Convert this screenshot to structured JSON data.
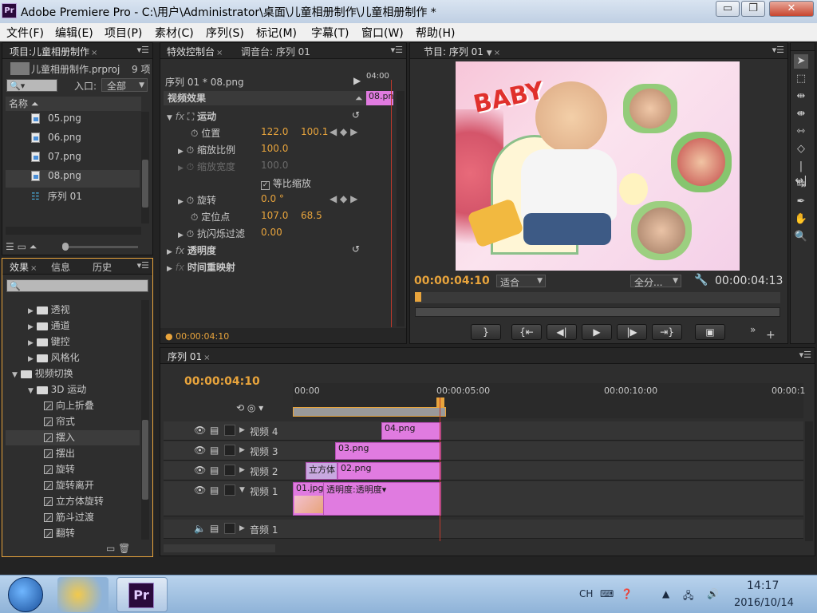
{
  "window": {
    "app_icon": "Pr",
    "title": "Adobe Premiere Pro - C:\\用户\\Administrator\\桌面\\儿童相册制作\\儿童相册制作 *",
    "minimize": "▭",
    "maximize": "❐",
    "close": "✕"
  },
  "menu": [
    "文件(F)",
    "编辑(E)",
    "项目(P)",
    "素材(C)",
    "序列(S)",
    "标记(M)",
    "字幕(T)",
    "窗口(W)",
    "帮助(H)"
  ],
  "project": {
    "tab": "项目:儿童相册制作",
    "file": "儿童相册制作.prproj",
    "count": "9 项",
    "entry_label": "入口:",
    "entry_value": "全部",
    "name_header": "名称",
    "items": [
      "05.png",
      "06.png",
      "07.png",
      "08.png",
      "序列 01"
    ]
  },
  "effects": {
    "tabs": [
      "效果",
      "信息",
      "历史"
    ],
    "tree": [
      {
        "label": "透视",
        "kind": "folder",
        "indent": 1
      },
      {
        "label": "通道",
        "kind": "folder",
        "indent": 1
      },
      {
        "label": "键控",
        "kind": "folder",
        "indent": 1
      },
      {
        "label": "风格化",
        "kind": "folder",
        "indent": 1
      },
      {
        "label": "视频切换",
        "kind": "folder",
        "indent": 0
      },
      {
        "label": "3D 运动",
        "kind": "folder",
        "indent": 1
      },
      {
        "label": "向上折叠",
        "kind": "effect",
        "indent": 2
      },
      {
        "label": "帘式",
        "kind": "effect",
        "indent": 2
      },
      {
        "label": "摆入",
        "kind": "effect",
        "indent": 2
      },
      {
        "label": "摆出",
        "kind": "effect",
        "indent": 2
      },
      {
        "label": "旋转",
        "kind": "effect",
        "indent": 2
      },
      {
        "label": "旋转离开",
        "kind": "effect",
        "indent": 2
      },
      {
        "label": "立方体旋转",
        "kind": "effect",
        "indent": 2
      },
      {
        "label": "筋斗过渡",
        "kind": "effect",
        "indent": 2
      },
      {
        "label": "翻转",
        "kind": "effect",
        "indent": 2
      }
    ]
  },
  "effect_controls": {
    "tabs": [
      "特效控制台",
      "调音台: 序列 01"
    ],
    "clip_path": "序列 01 * 08.png",
    "time_label": "04:00",
    "clip_label": "08.pn",
    "section": "视频效果",
    "motion": "运动",
    "position": {
      "label": "位置",
      "x": "122.0",
      "y": "100.1"
    },
    "scale": {
      "label": "缩放比例",
      "value": "100.0"
    },
    "scale_width": {
      "label": "缩放宽度",
      "value": "100.0"
    },
    "uniform": "等比缩放",
    "rotation": {
      "label": "旋转",
      "value": "0.0 °"
    },
    "anchor": {
      "label": "定位点",
      "x": "107.0",
      "y": "68.5"
    },
    "antiflicker": {
      "label": "抗闪烁过滤",
      "value": "0.00"
    },
    "opacity": "透明度",
    "timeremap": "时间重映射",
    "timecode": "00:00:04:10"
  },
  "program": {
    "tab": "节目: 序列 01",
    "timecode": "00:00:04:10",
    "fit": "适合",
    "quality": "全分...",
    "duration": "00:00:04:13",
    "baby_text": "BABY"
  },
  "timeline": {
    "tab": "序列 01",
    "timecode": "00:00:04:10",
    "ruler": [
      "00:00",
      "00:00:05:00",
      "00:00:10:00",
      "00:00:1"
    ],
    "tracks": [
      {
        "name": "视频 4",
        "clips": [
          {
            "label": "04.png"
          }
        ]
      },
      {
        "name": "视频 3",
        "clips": [
          {
            "label": "03.png"
          }
        ]
      },
      {
        "name": "视频 2",
        "clips": [
          {
            "label": "立方体"
          },
          {
            "label": "02.png"
          }
        ]
      },
      {
        "name": "视频 1",
        "clips": [
          {
            "label": "01.jpg"
          },
          {
            "label": "透明度:透明度▾"
          }
        ]
      },
      {
        "name": "音频 1",
        "clips": []
      }
    ]
  },
  "taskbar": {
    "ime": "CH",
    "time": "14:17",
    "date": "2016/10/14",
    "pr_label": "Pr"
  },
  "colors": {
    "accent": "#e8a43c",
    "clip": "#e07be0",
    "titlebar": "#c9d8ea"
  }
}
